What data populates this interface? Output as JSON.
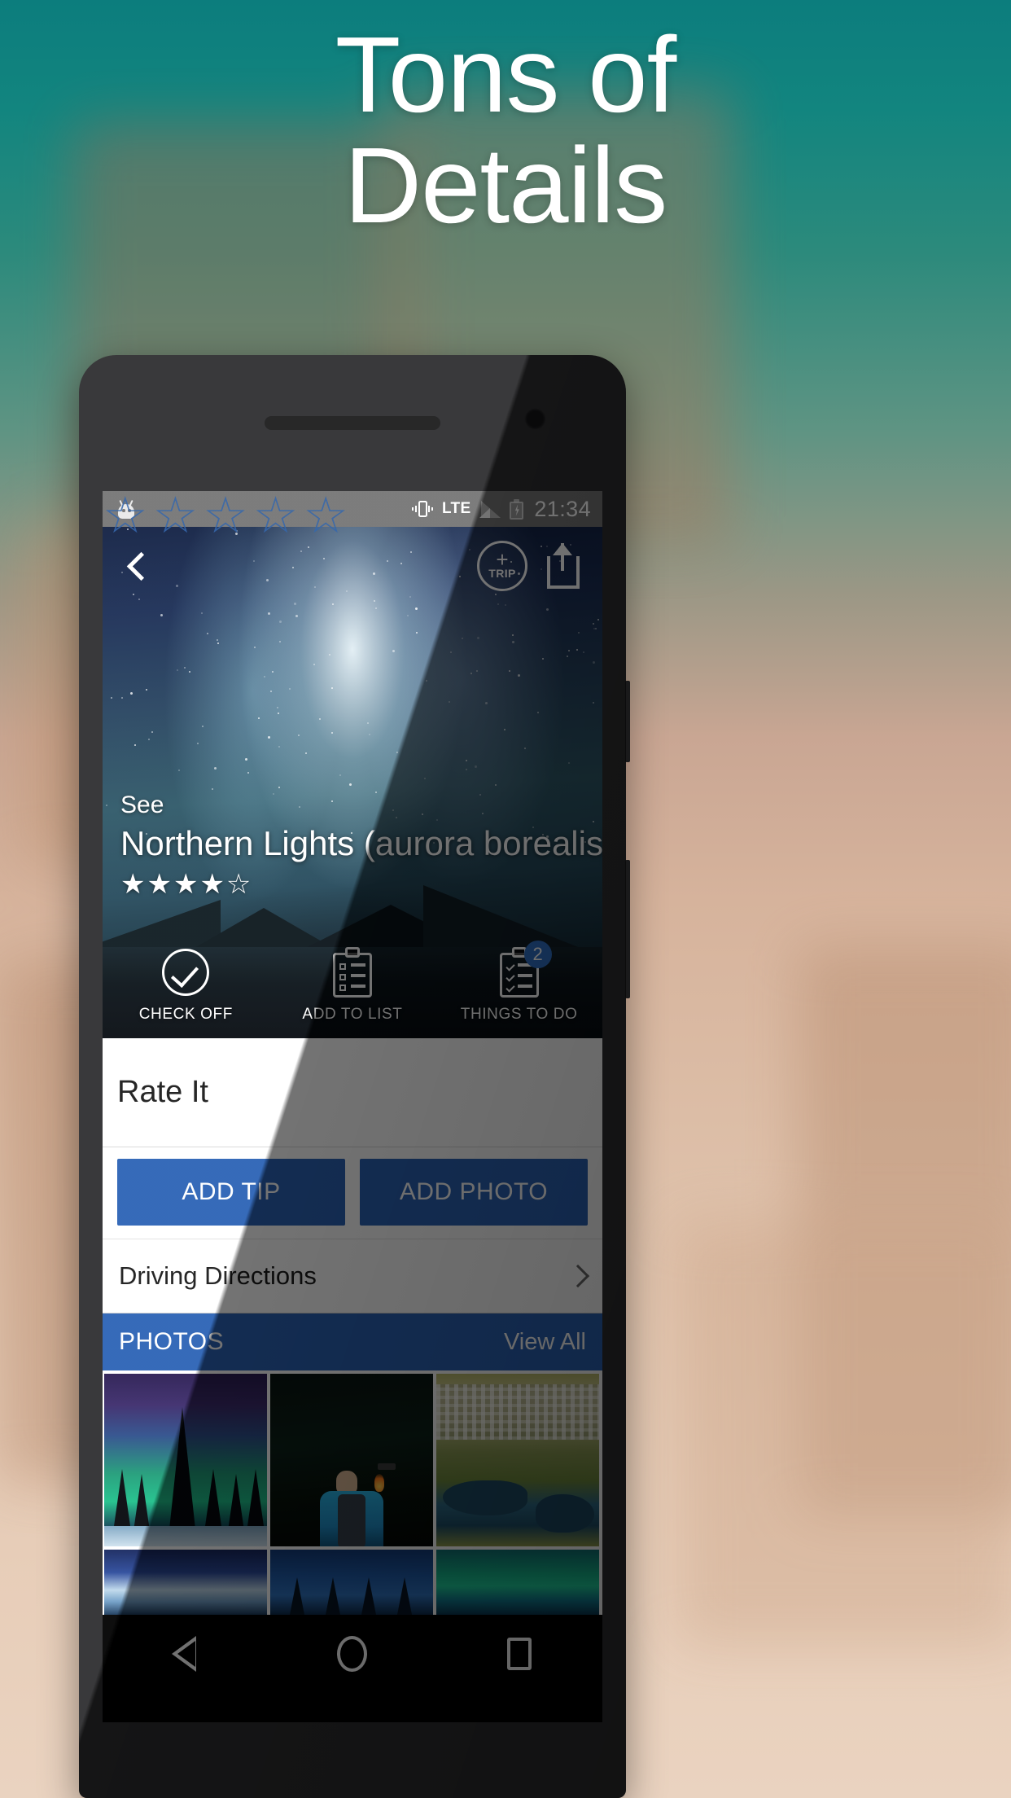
{
  "promo": {
    "headline_line1": "Tons of",
    "headline_line2": "Details",
    "bg_top_color": "#0c7d7d",
    "bg_bottom_color": "#ead3c0"
  },
  "statusbar": {
    "notification_icon": "android-head-icon",
    "vibrate_icon": "vibrate-icon",
    "network": "LTE",
    "signal_icon": "signal-bars-icon",
    "battery_icon": "battery-charging-icon",
    "time": "21:34"
  },
  "topbar": {
    "back_icon": "back-chevron-icon",
    "trip_plus": "+",
    "trip_label": "TRIP",
    "share_icon": "share-upload-icon"
  },
  "hero": {
    "kicker": "See",
    "title": "Northern Lights (aurora borealis)",
    "rating_stars": "★★★★☆",
    "rating_value": 4,
    "rating_max": 5
  },
  "actions": [
    {
      "label": "CHECK OFF",
      "icon": "circle-check-icon",
      "badge": null
    },
    {
      "label": "ADD TO LIST",
      "icon": "clipboard-icon",
      "badge": null
    },
    {
      "label": "THINGS TO DO",
      "icon": "checklist-icon",
      "badge": "2"
    }
  ],
  "rate": {
    "label": "Rate It",
    "star_icon": "star-outline-icon",
    "star_count": 5,
    "selected": 0,
    "star_color": "#2a5fa8"
  },
  "buttons": {
    "add_tip": "ADD TIP",
    "add_photo": "ADD PHOTO",
    "accent_color": "#2a62b5"
  },
  "directions": {
    "label": "Driving Directions",
    "chevron_icon": "chevron-right-icon"
  },
  "photos": {
    "section_title": "PHOTOS",
    "view_all": "View All",
    "header_color": "#2a62b5",
    "thumbs": [
      {
        "name": "aurora-over-pine-forest"
      },
      {
        "name": "person-with-torch-at-night"
      },
      {
        "name": "aerial-view-town-and-lakes"
      },
      {
        "name": "aurora-blue-sky"
      },
      {
        "name": "aurora-over-firs"
      },
      {
        "name": "aurora-green-teal"
      }
    ]
  },
  "navbar": {
    "back": "nav-back-icon",
    "home": "nav-home-icon",
    "recents": "nav-recents-icon"
  }
}
